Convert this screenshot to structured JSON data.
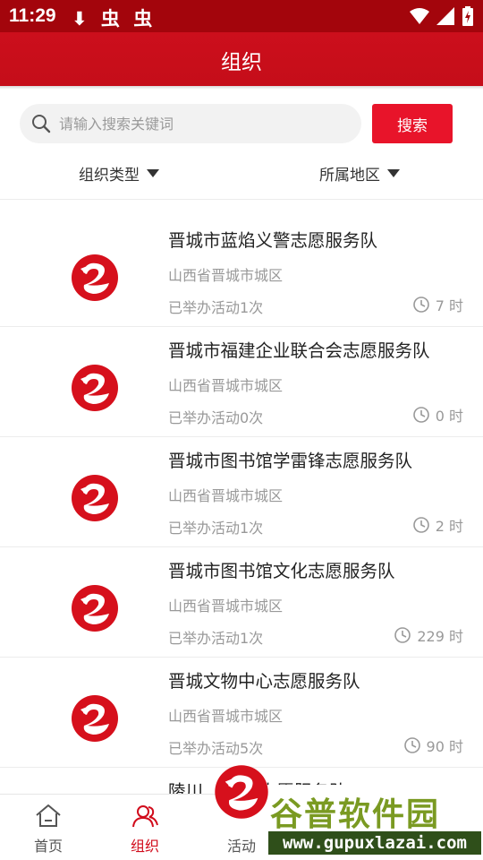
{
  "status_bar": {
    "time": "11:29",
    "left_icons": "⬇ 虫 虫"
  },
  "header": {
    "title": "组织"
  },
  "search": {
    "placeholder": "请输入搜索关键词",
    "value": "",
    "button_label": "搜索"
  },
  "filters": {
    "type_label": "组织类型",
    "region_label": "所属地区"
  },
  "organizations": [
    {
      "name": "晋城市蓝焰义警志愿服务队",
      "area": "山西省晋城市城区",
      "activity": "已举办活动1次",
      "hours": "7 时"
    },
    {
      "name": "晋城市福建企业联合会志愿服务队",
      "area": "山西省晋城市城区",
      "activity": "已举办活动0次",
      "hours": "0 时"
    },
    {
      "name": "晋城市图书馆学雷锋志愿服务队",
      "area": "山西省晋城市城区",
      "activity": "已举办活动1次",
      "hours": "2 时"
    },
    {
      "name": "晋城市图书馆文化志愿服务队",
      "area": "山西省晋城市城区",
      "activity": "已举办活动1次",
      "hours": "229 时"
    },
    {
      "name": "晋城文物中心志愿服务队",
      "area": "山西省晋城市城区",
      "activity": "已举办活动5次",
      "hours": "90 时"
    },
    {
      "name": "陵川...  ...技志愿服务队",
      "area": "",
      "activity": "",
      "hours": ""
    }
  ],
  "nav": [
    {
      "label": "首页",
      "icon": "home-icon"
    },
    {
      "label": "组织",
      "icon": "people-icon",
      "active": true
    },
    {
      "label": "活动",
      "icon": "activity-icon"
    }
  ],
  "watermark": {
    "name": "谷普软件园",
    "url": "www.gupuxlazai.com"
  },
  "colors": {
    "header": "#c50d19",
    "status_bar": "#a3050c",
    "accent": "#e8142a",
    "muted_text": "#999999"
  }
}
